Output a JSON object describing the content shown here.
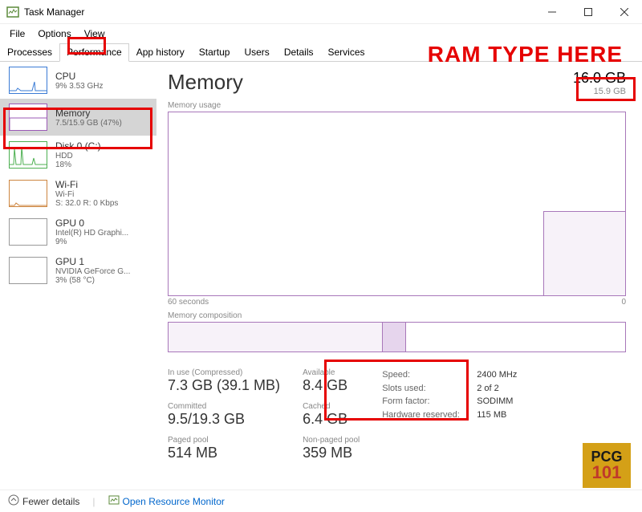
{
  "window": {
    "title": "Task Manager"
  },
  "menu": {
    "file": "File",
    "options": "Options",
    "view": "View"
  },
  "tabs": {
    "processes": "Processes",
    "performance": "Performance",
    "app_history": "App history",
    "startup": "Startup",
    "users": "Users",
    "details": "Details",
    "services": "Services"
  },
  "sidebar": {
    "cpu": {
      "name": "CPU",
      "detail": "9% 3.53 GHz"
    },
    "memory": {
      "name": "Memory",
      "detail": "7.5/15.9 GB (47%)"
    },
    "disk": {
      "name": "Disk 0 (C:)",
      "detail1": "HDD",
      "detail2": "18%"
    },
    "wifi": {
      "name": "Wi-Fi",
      "detail1": "Wi-Fi",
      "detail2": "S: 32.0 R: 0 Kbps"
    },
    "gpu0": {
      "name": "GPU 0",
      "detail1": "Intel(R) HD Graphi...",
      "detail2": "9%"
    },
    "gpu1": {
      "name": "GPU 1",
      "detail1": "NVIDIA GeForce G...",
      "detail2": "3% (58 °C)"
    }
  },
  "main": {
    "title": "Memory",
    "total": "16.0 GB",
    "total_sub": "15.9 GB",
    "chart_label": "Memory usage",
    "axis_left": "60 seconds",
    "axis_right": "0",
    "comp_label": "Memory composition"
  },
  "stats": {
    "in_use_lbl": "In use (Compressed)",
    "in_use_val": "7.3 GB (39.1 MB)",
    "available_lbl": "Available",
    "available_val": "8.4 GB",
    "committed_lbl": "Committed",
    "committed_val": "9.5/19.3 GB",
    "cached_lbl": "Cached",
    "cached_val": "6.4 GB",
    "paged_lbl": "Paged pool",
    "paged_val": "514 MB",
    "nonpaged_lbl": "Non-paged pool",
    "nonpaged_val": "359 MB"
  },
  "specs": {
    "speed_k": "Speed:",
    "speed_v": "2400 MHz",
    "slots_k": "Slots used:",
    "slots_v": "2 of 2",
    "form_k": "Form factor:",
    "form_v": "SODIMM",
    "hw_k": "Hardware reserved:",
    "hw_v": "115 MB"
  },
  "footer": {
    "fewer": "Fewer details",
    "orm": "Open Resource Monitor"
  },
  "annotation": {
    "ramtype": "RAM TYPE HERE",
    "logo1": "PCG",
    "logo2": "101"
  },
  "chart_data": {
    "type": "line",
    "title": "Memory usage",
    "xlabel": "60 seconds → 0",
    "ylabel": "GB",
    "ylim": [
      0,
      15.9
    ],
    "series": [
      {
        "name": "In use",
        "values": [
          0,
          0,
          0,
          0,
          0,
          0,
          0,
          0,
          0,
          0,
          0,
          0,
          0,
          0,
          0,
          0,
          0,
          0,
          0,
          0,
          0,
          0,
          0,
          0,
          0,
          0,
          0,
          0,
          0,
          0,
          0,
          0,
          0,
          0,
          0,
          0,
          0,
          0,
          0,
          0,
          0,
          0,
          0,
          0,
          0,
          0,
          0,
          0,
          0,
          7.2,
          7.3,
          7.3,
          7.3,
          7.3,
          7.3,
          7.3,
          7.3,
          7.3,
          7.3,
          7.3
        ]
      }
    ]
  }
}
